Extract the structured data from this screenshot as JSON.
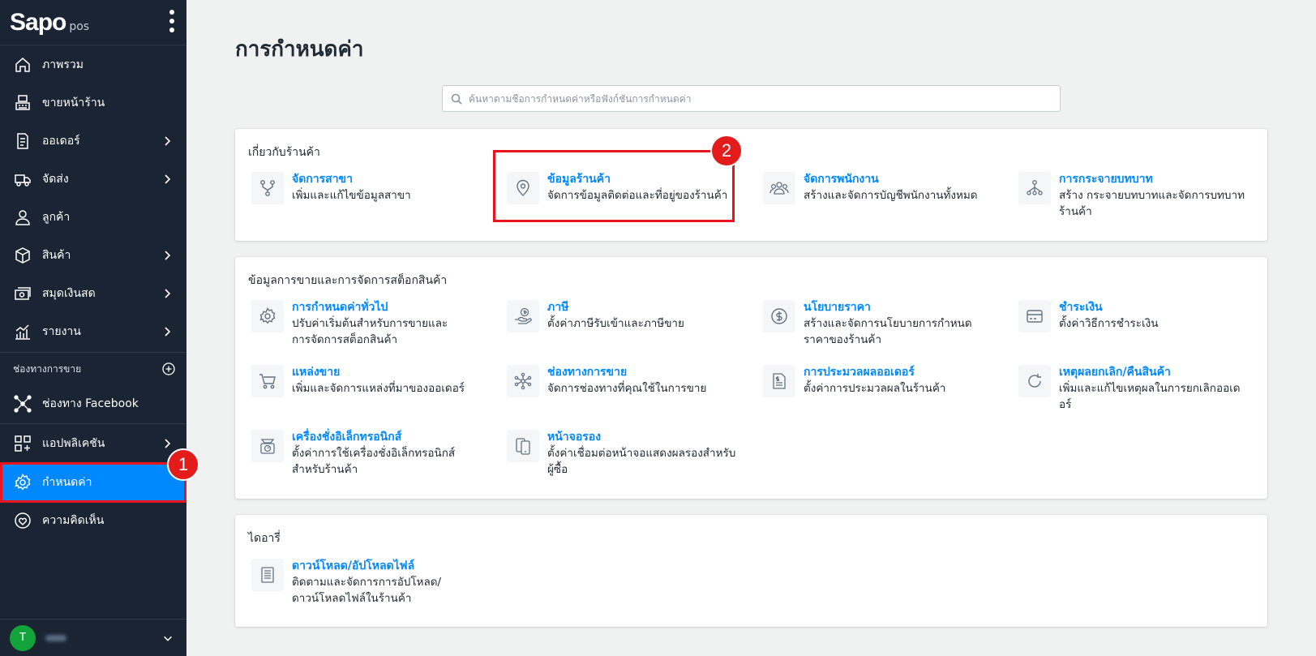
{
  "sidebar": {
    "logo": "Sapo",
    "logo_sub": "pos",
    "items": [
      {
        "label": "ภาพรวม",
        "icon": "home-icon"
      },
      {
        "label": "ขายหน้าร้าน",
        "icon": "pos-register-icon"
      },
      {
        "label": "ออเดอร์",
        "icon": "order-document-icon",
        "has_children": true
      },
      {
        "label": "จัดส่ง",
        "icon": "delivery-truck-icon",
        "has_children": true
      },
      {
        "label": "ลูกค้า",
        "icon": "customer-icon"
      },
      {
        "label": "สินค้า",
        "icon": "product-box-icon",
        "has_children": true
      },
      {
        "label": "สมุดเงินสด",
        "icon": "cashbook-icon",
        "has_children": true
      },
      {
        "label": "รายงาน",
        "icon": "report-chart-icon",
        "has_children": true
      }
    ],
    "channels_title": "ช่องทางการขาย",
    "channel_facebook": "ช่องทาง Facebook",
    "apps_label": "แอปพลิเคชัน",
    "settings_label": "กำหนดค่า",
    "feedback_label": "ความคิดเห็น",
    "user_initial": "T",
    "colors": {
      "bg": "#1a2433",
      "active": "#0088ff",
      "highlight": "#e8161c"
    }
  },
  "badges": {
    "one": "1",
    "two": "2"
  },
  "main": {
    "title": "การกำหนดค่า",
    "search_placeholder": "ค้นหาตามชื่อการกำหนดค่าหรือฟังก์ชันการกำหนดค่า",
    "sections": [
      {
        "title": "เกี่ยวกับร้านค้า",
        "tiles": [
          {
            "title": "จัดการสาขา",
            "desc": "เพิ่มและแก้ไขข้อมูลสาขา",
            "icon": "branch-icon"
          },
          {
            "title": "ข้อมูลร้านค้า",
            "desc": "จัดการข้อมูลติดต่อและที่อยู่ของร้านค้า",
            "icon": "location-pin-icon"
          },
          {
            "title": "จัดการพนักงาน",
            "desc": "สร้างและจัดการบัญชีพนักงานทั้งหมด",
            "icon": "staff-group-icon"
          },
          {
            "title": "การกระจายบทบาท",
            "desc": "สร้าง กระจายบทบาทและจัดการบทบาทร้านค้า",
            "icon": "role-hierarchy-icon"
          }
        ]
      },
      {
        "title": "ข้อมูลการขายและการจัดการสต็อกสินค้า",
        "tiles": [
          {
            "title": "การกำหนดค่าทั่วไป",
            "desc": "ปรับค่าเริ่มต้นสำหรับการขายและการจัดการสต็อกสินค้า",
            "icon": "gear-icon"
          },
          {
            "title": "ภาษี",
            "desc": "ตั้งค่าภาษีรับเข้าและภาษีขาย",
            "icon": "tax-hand-icon"
          },
          {
            "title": "นโยบายราคา",
            "desc": "สร้างและจัดการนโยบายการกำหนดราคาของร้านค้า",
            "icon": "dollar-circle-icon"
          },
          {
            "title": "ชำระเงิน",
            "desc": "ตั้งค่าวิธีการชำระเงิน",
            "icon": "credit-card-icon"
          },
          {
            "title": "แหล่งขาย",
            "desc": "เพิ่มและจัดการแหล่งที่มาของออเดอร์",
            "icon": "cart-icon"
          },
          {
            "title": "ช่องทางการขาย",
            "desc": "จัดการช่องทางที่คุณใช้ในการขาย",
            "icon": "network-icon"
          },
          {
            "title": "การประมวลผลออเดอร์",
            "desc": "ตั้งค่าการประมวลผลในร้านค้า",
            "icon": "order-process-icon"
          },
          {
            "title": "เหตุผลยกเลิก/คืนสินค้า",
            "desc": "เพิ่มและแก้ไขเหตุผลในการยกเลิกออเดอร์",
            "icon": "refresh-icon"
          },
          {
            "title": "เครื่องชั่งอิเล็กทรอนิกส์",
            "desc": "ตั้งค่าการใช้เครื่องชั่งอิเล็กทรอนิกส์สำหรับร้านค้า",
            "icon": "scale-icon"
          },
          {
            "title": "หน้าจอรอง",
            "desc": "ตั้งค่าเชื่อมต่อหน้าจอแสดงผลรองสำหรับผู้ซื้อ",
            "icon": "second-screen-icon"
          }
        ]
      },
      {
        "title": "ไดอารี่",
        "tiles": [
          {
            "title": "ดาวน์โหลด/อัปโหลดไฟล์",
            "desc": "ติดตามและจัดการการอัปโหลด/ดาวน์โหลดไฟล์ในร้านค้า",
            "icon": "file-list-icon"
          }
        ]
      }
    ]
  }
}
